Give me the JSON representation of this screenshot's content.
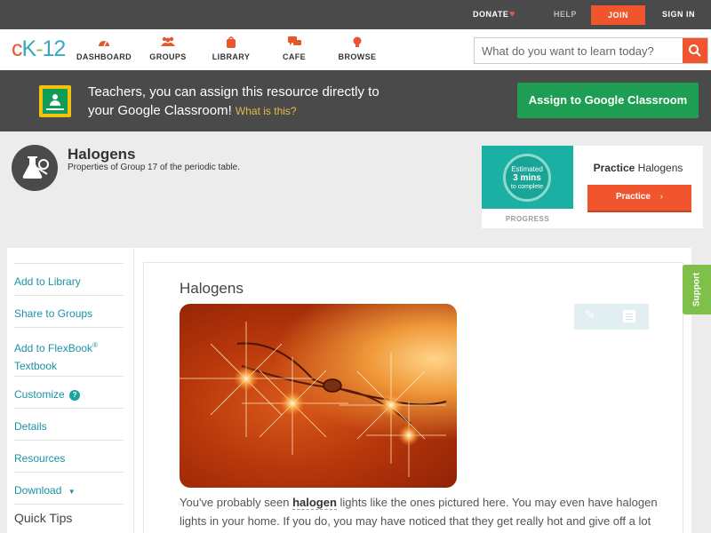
{
  "topbar": {
    "donate": "DONATE",
    "help": "HELP",
    "join": "JOIN",
    "signin": "SIGN IN"
  },
  "nav": {
    "logo": {
      "c": "c",
      "k": "K",
      "dash": "-",
      "n": "12"
    },
    "items": [
      {
        "label": "DASHBOARD",
        "icon": "dashboard-gauge-icon"
      },
      {
        "label": "GROUPS",
        "icon": "groups-people-icon"
      },
      {
        "label": "LIBRARY",
        "icon": "library-bag-icon"
      },
      {
        "label": "CAFE",
        "icon": "cafe-chat-icon"
      },
      {
        "label": "BROWSE",
        "icon": "browse-bulb-icon"
      }
    ],
    "search_placeholder": "What do you want to learn today?"
  },
  "banner": {
    "text": "Teachers, you can assign this resource directly to your Google Classroom!",
    "what": "What is this?",
    "assign": "Assign to Google Classroom"
  },
  "header": {
    "title": "Halogens",
    "subtitle": "Properties of Group 17 of the periodic table."
  },
  "practice": {
    "estimated": "Estimated",
    "mins": "3 mins",
    "complete": "to complete",
    "progress": "PROGRESS",
    "title_bold": "Practice",
    "title_rest": "Halogens",
    "button": "Practice"
  },
  "sidebar": {
    "add_library": "Add to Library",
    "share_groups": "Share to Groups",
    "add_flexbook": "Add to FlexBook",
    "reg": "®",
    "textbook": "Textbook",
    "customize": "Customize",
    "details": "Details",
    "resources": "Resources",
    "download": "Download",
    "quick_tips": "Quick Tips"
  },
  "content": {
    "title": "Halogens",
    "p_start": "You've probably seen",
    "p_keyword": "halogen",
    "p_end": "lights like the ones pictured here. You may even have halogen lights in your home. If you do, you may have noticed that they get really hot and give off a lot of"
  },
  "support": "Support"
}
